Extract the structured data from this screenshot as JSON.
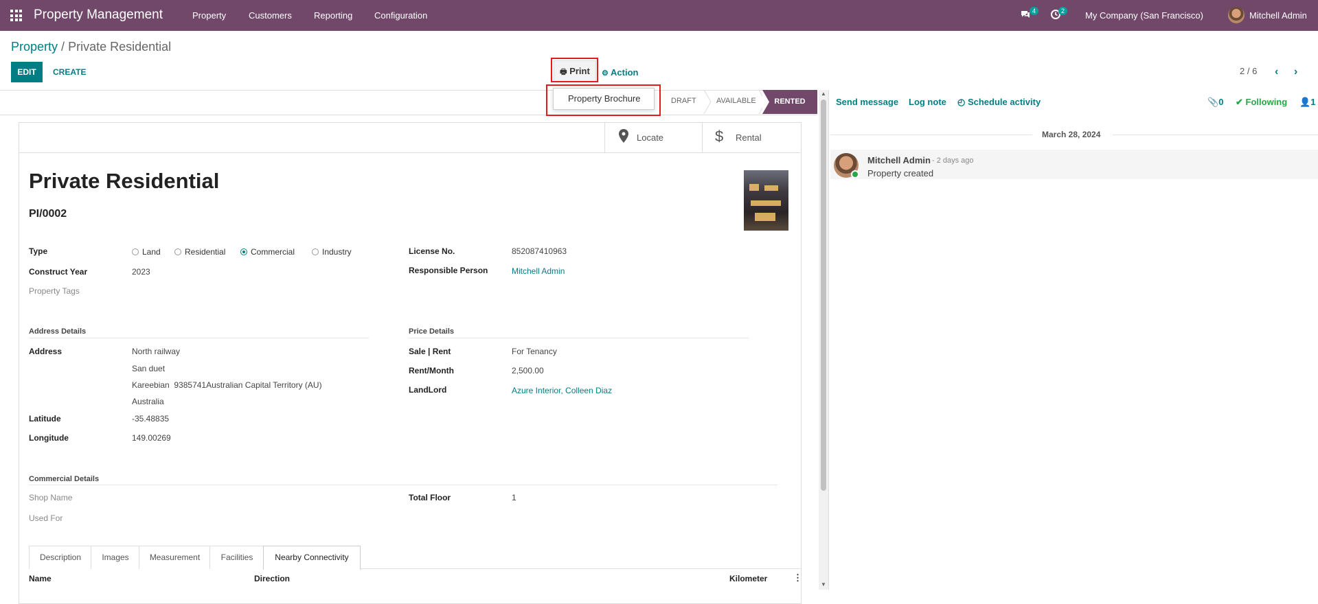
{
  "navbar": {
    "brand": "Property Management",
    "menu": [
      "Property",
      "Customers",
      "Reporting",
      "Configuration"
    ],
    "messages_count": "4",
    "activities_count": "2",
    "company": "My Company (San Francisco)",
    "user": "Mitchell Admin",
    "color": "#71476a"
  },
  "breadcrumb": {
    "parent": "Property",
    "separator": "/",
    "current": "Private Residential"
  },
  "buttons": {
    "edit": "EDIT",
    "create": "CREATE",
    "print": "Print",
    "action": "Action"
  },
  "pager": {
    "value": "2 / 6"
  },
  "print_dropdown": {
    "items": [
      "Property Brochure"
    ]
  },
  "stages": {
    "draft": "DRAFT",
    "available": "AVAILABLE",
    "rented": "RENTED",
    "active": "RENTED"
  },
  "smart_buttons": {
    "locate": "Locate",
    "rental": "Rental"
  },
  "record": {
    "title": "Private Residential",
    "reference": "PI/0002",
    "type_label": "Type",
    "type_options": [
      "Land",
      "Residential",
      "Commercial",
      "Industry"
    ],
    "type_selected": "Commercial",
    "construct_year_label": "Construct Year",
    "construct_year": "2023",
    "tags_label": "Property Tags",
    "license_label": "License No.",
    "license": "852087410963",
    "responsible_label": "Responsible Person",
    "responsible": "Mitchell Admin"
  },
  "address": {
    "section": "Address Details",
    "label": "Address",
    "line1": "North railway",
    "line2": "San duet",
    "line3": "Kareebian  9385741Australian Capital Territory (AU)",
    "line4": "Australia",
    "latitude_label": "Latitude",
    "latitude": "-35.48835",
    "longitude_label": "Longitude",
    "longitude": "149.00269"
  },
  "price": {
    "section": "Price Details",
    "sale_rent_label": "Sale | Rent",
    "sale_rent": "For Tenancy",
    "rent_month_label": "Rent/Month",
    "rent_month": "2,500.00",
    "landlord_label": "LandLord",
    "landlord": "Azure Interior, Colleen Diaz"
  },
  "commercial": {
    "section": "Commercial Details",
    "shop_name_label": "Shop Name",
    "used_for_label": "Used For",
    "total_floor_label": "Total Floor",
    "total_floor": "1"
  },
  "tabs": {
    "items": [
      "Description",
      "Images",
      "Measurement",
      "Facilities",
      "Nearby Connectivity"
    ],
    "active": "Nearby Connectivity",
    "columns": [
      "Name",
      "Direction",
      "Kilometer"
    ]
  },
  "chatter": {
    "send_message": "Send message",
    "log_note": "Log note",
    "schedule_activity": "Schedule activity",
    "attachments": "0",
    "following": "Following",
    "followers": "1",
    "date": "March 28, 2024",
    "message": {
      "author": "Mitchell Admin",
      "time": "- 2 days ago",
      "body": "Property created"
    }
  },
  "icons": {
    "apps": "apps-grid-icon",
    "chat": "chat-icon",
    "clock": "clock-icon",
    "print": "printer-icon",
    "gear": "gear-icon",
    "locate": "map-marker-icon",
    "rental": "dollar-icon",
    "paperclip": "paperclip-icon",
    "check": "check-icon",
    "user": "user-icon"
  }
}
